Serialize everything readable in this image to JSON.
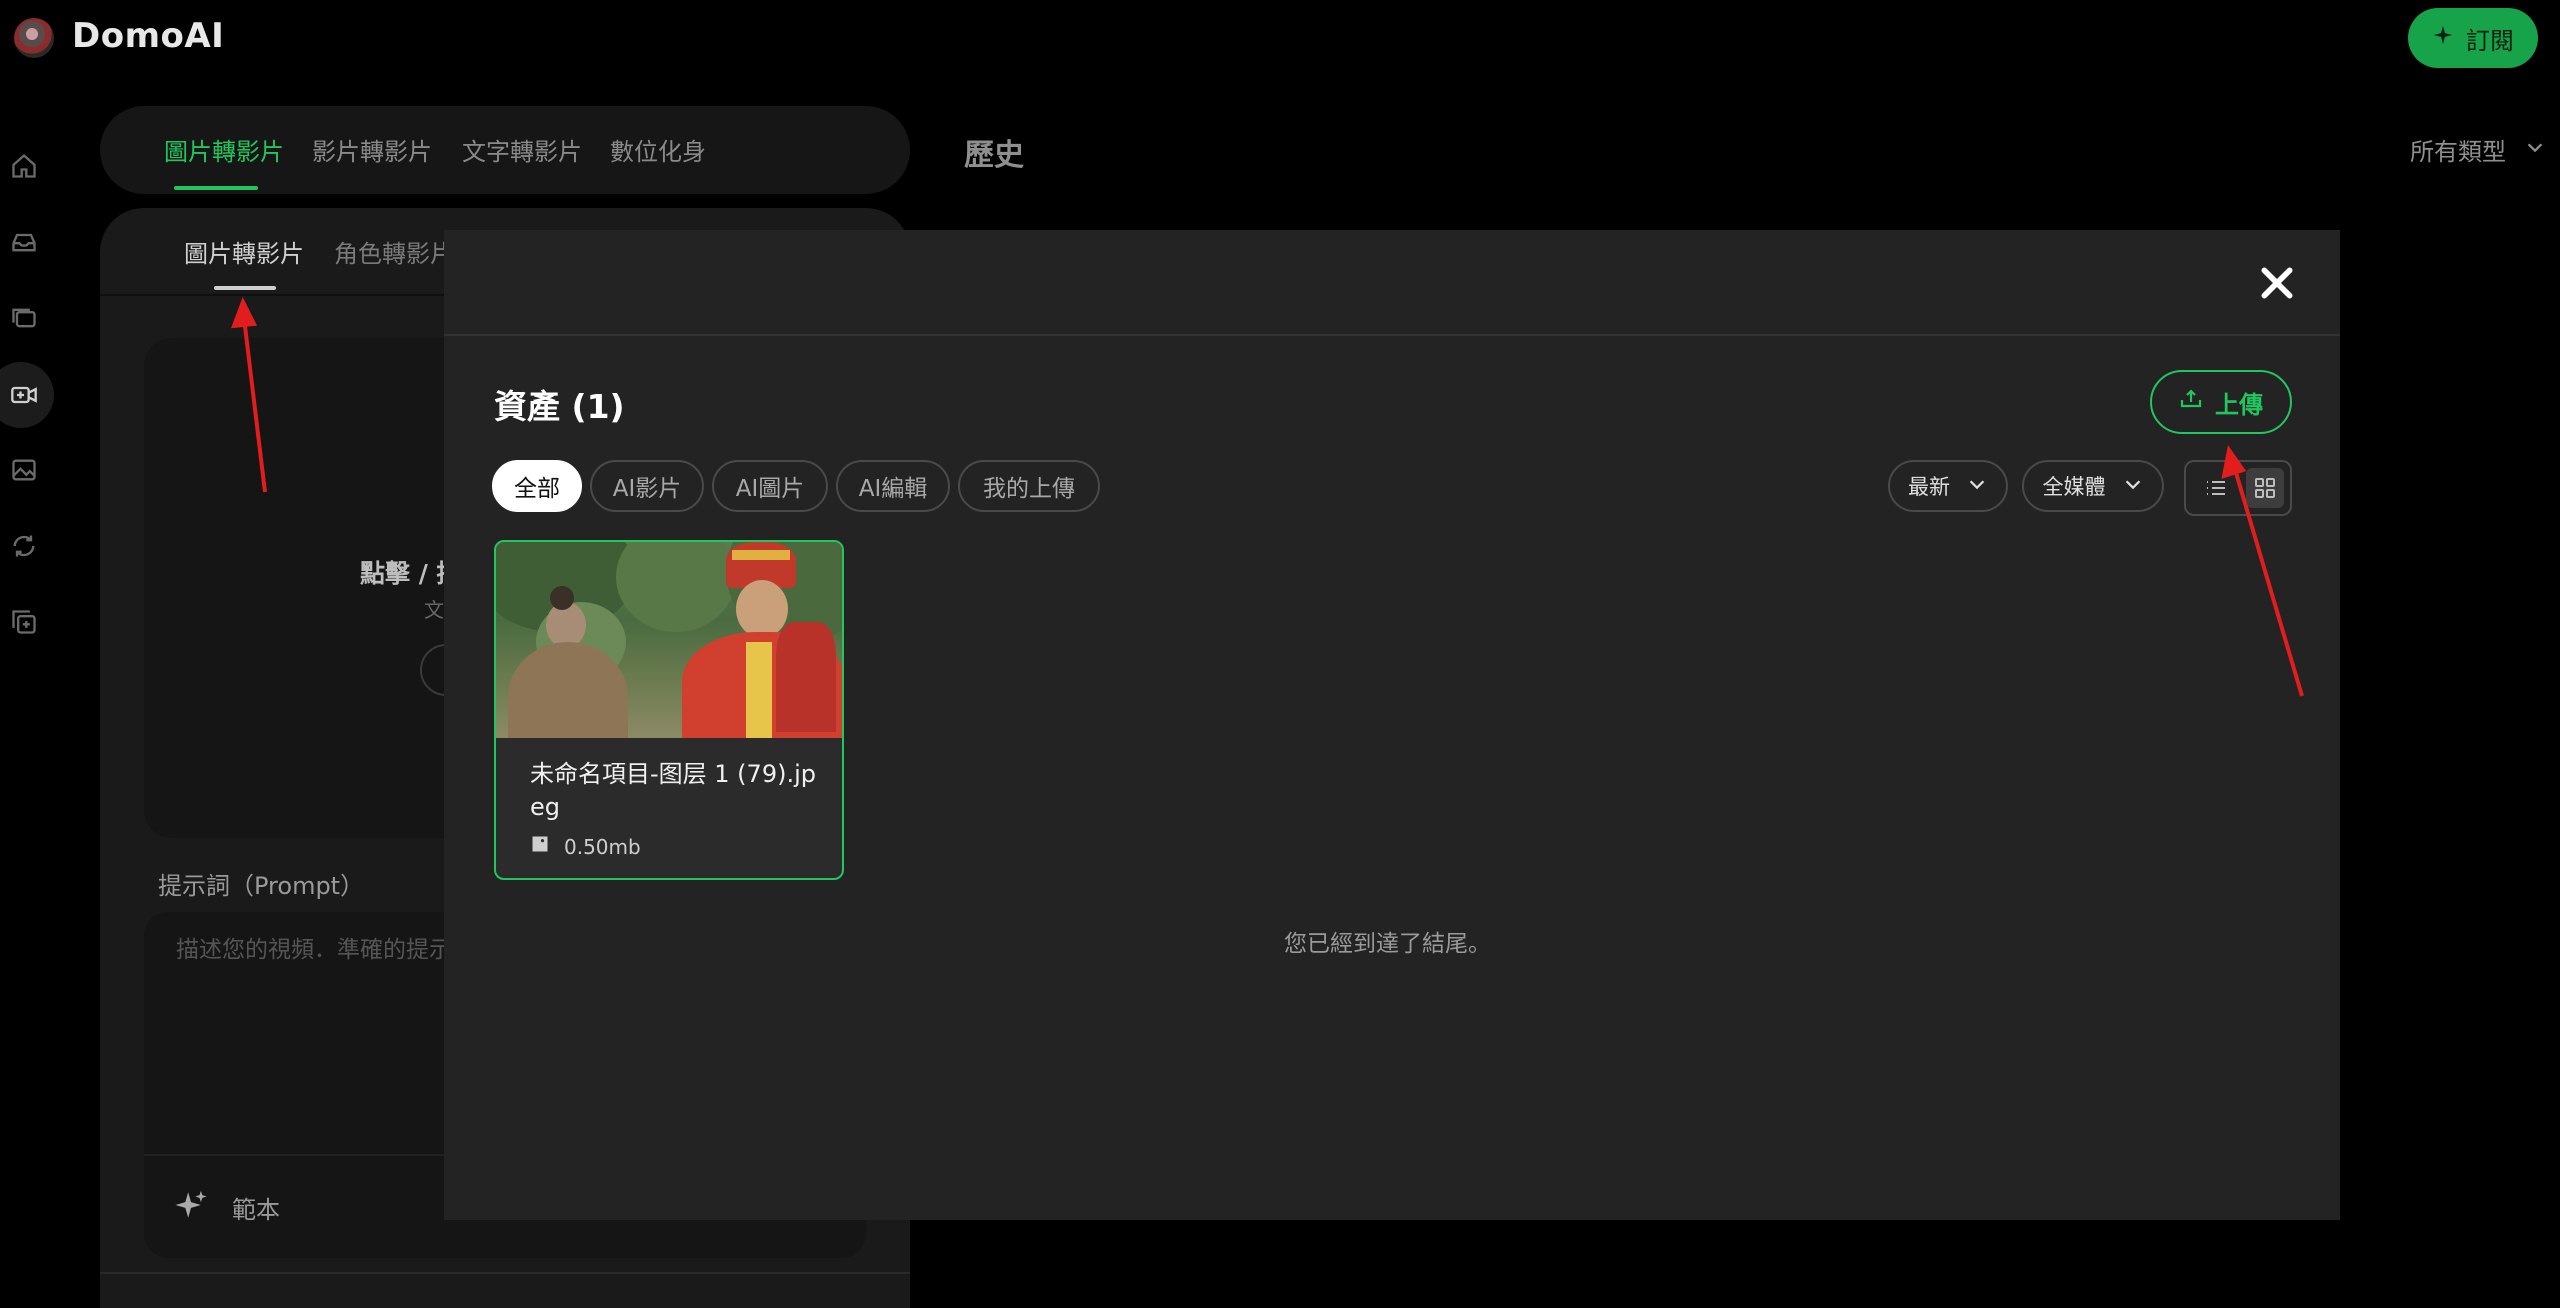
{
  "app": {
    "logo_text": "DomoAI",
    "subscribe_label": "訂閱",
    "accent_color": "#22c55e"
  },
  "sidebar": {
    "icons": [
      "home-icon",
      "inbox-icon",
      "gallery-icon",
      "video-camera-icon",
      "image-icon",
      "refresh-icon",
      "add-layer-icon"
    ]
  },
  "main_tabs": [
    {
      "label": "圖片轉影片",
      "active": true
    },
    {
      "label": "影片轉影片",
      "active": false
    },
    {
      "label": "文字轉影片",
      "active": false
    },
    {
      "label": "數位化身",
      "active": false
    }
  ],
  "sub_tabs": [
    {
      "label": "圖片轉影片",
      "active": true
    },
    {
      "label": "角色轉影片",
      "active": false
    }
  ],
  "upload_area": {
    "title": "點擊 / 拖",
    "subtitle": "文"
  },
  "prompt": {
    "label": "提示詞（Prompt）",
    "placeholder": "描述您的視頻．準確的提示",
    "template_label": "範本"
  },
  "history": {
    "title": "歷史",
    "type_filter": "所有類型"
  },
  "modal": {
    "assets_title": "資產 (1)",
    "upload_label": "上傳",
    "filter_chips": [
      "全部",
      "AI影片",
      "AI圖片",
      "AI編輯",
      "我的上傳"
    ],
    "active_chip": "全部",
    "sort_label": "最新",
    "media_label": "全媒體",
    "view_mode": "grid",
    "assets": [
      {
        "name": "未命名項目-图层 1 (79).jpeg",
        "size": "0.50mb",
        "type": "image"
      }
    ],
    "end_text": "您已經到達了結尾。"
  }
}
